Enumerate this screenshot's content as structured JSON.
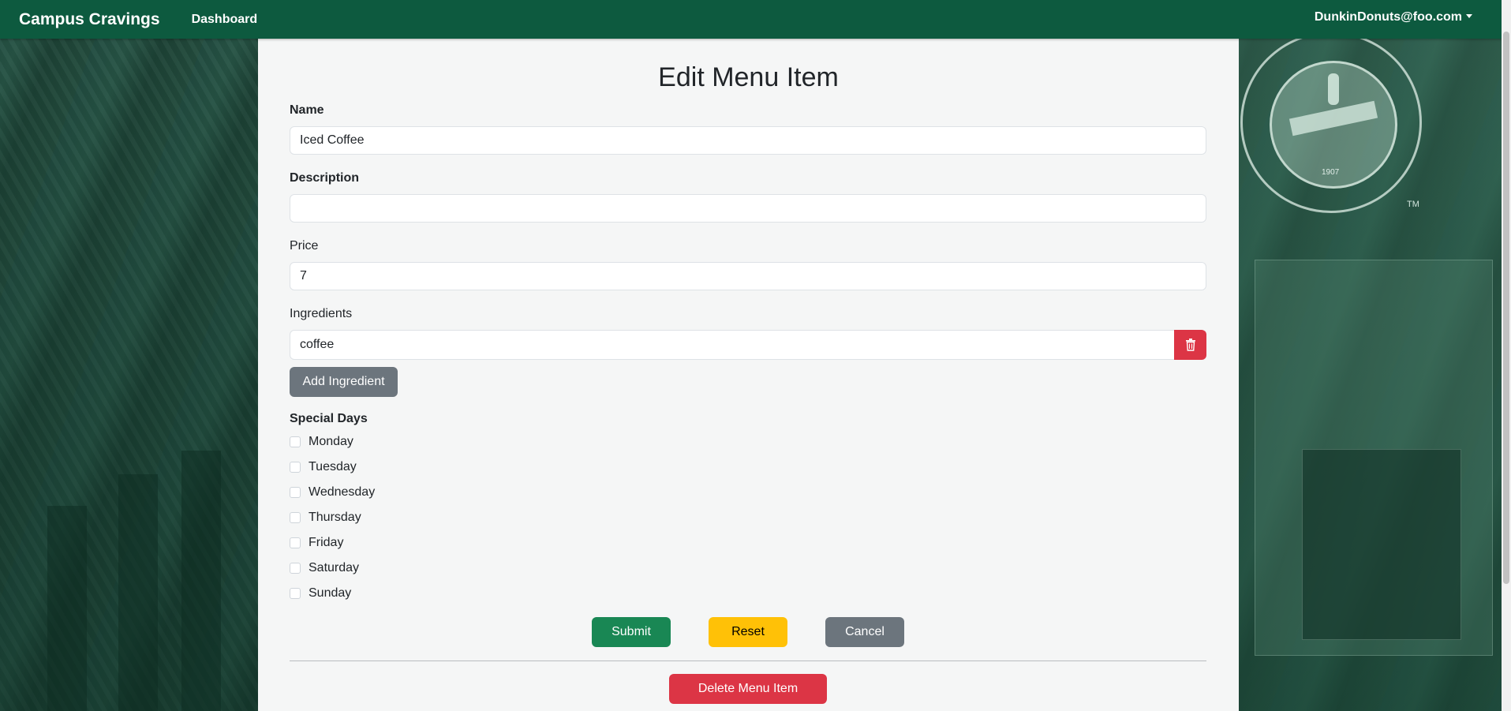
{
  "navbar": {
    "brand": "Campus Cravings",
    "dashboard_link": "Dashboard",
    "user_menu": "DunkinDonuts@foo.com",
    "bg_color": "#0d5a3f"
  },
  "background": {
    "seal_year": "1907",
    "seal_tm": "TM"
  },
  "form": {
    "title": "Edit Menu Item",
    "name_label": "Name",
    "name_value": "Iced Coffee",
    "description_label": "Description",
    "description_value": "",
    "price_label": "Price",
    "price_value": "7",
    "ingredients_label": "Ingredients",
    "ingredients": [
      {
        "value": "coffee",
        "remove_icon": "trash-icon"
      }
    ],
    "add_ingredient_label": "Add Ingredient",
    "special_days_label": "Special Days",
    "days": [
      {
        "label": "Monday",
        "checked": false
      },
      {
        "label": "Tuesday",
        "checked": false
      },
      {
        "label": "Wednesday",
        "checked": false
      },
      {
        "label": "Thursday",
        "checked": false
      },
      {
        "label": "Friday",
        "checked": false
      },
      {
        "label": "Saturday",
        "checked": false
      },
      {
        "label": "Sunday",
        "checked": false
      }
    ],
    "submit_label": "Submit",
    "reset_label": "Reset",
    "cancel_label": "Cancel",
    "delete_label": "Delete Menu Item"
  },
  "colors": {
    "submit": "#198754",
    "reset": "#ffc107",
    "cancel": "#6c757d",
    "delete": "#dc3545"
  }
}
